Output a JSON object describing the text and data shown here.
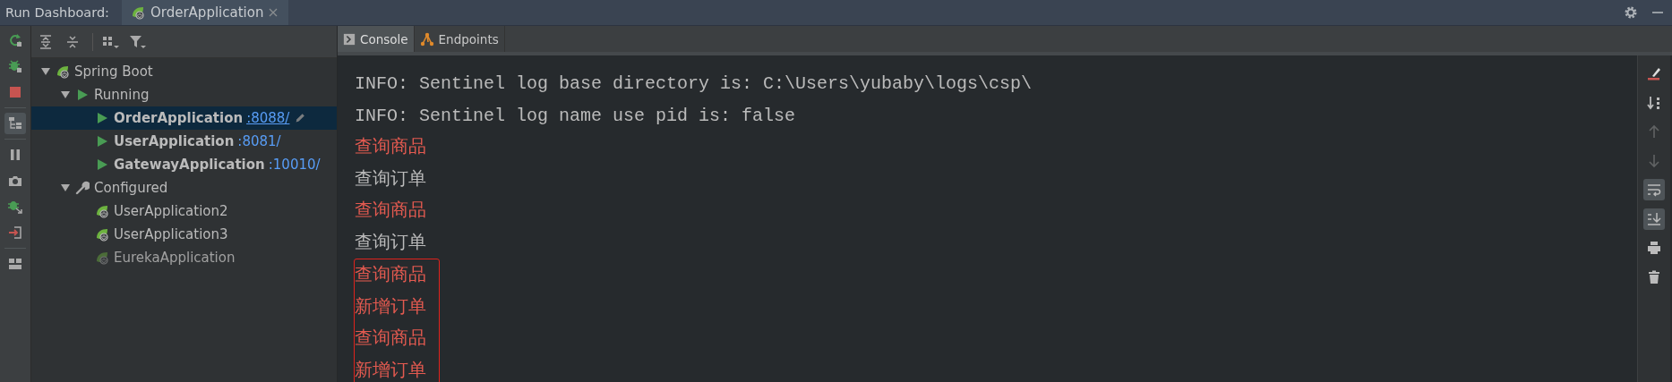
{
  "title_bar": {
    "label": "Run Dashboard:",
    "tab": {
      "title": "OrderApplication",
      "selected": true
    }
  },
  "left_toolbar": [
    {
      "kind": "rerun",
      "on": false
    },
    {
      "kind": "debug",
      "on": false
    },
    {
      "kind": "stop",
      "on": false
    },
    {
      "kind": "group_tree",
      "on": true
    },
    {
      "kind": "pause",
      "on": false
    },
    {
      "kind": "camera",
      "on": false
    },
    {
      "kind": "debug_attach",
      "on": false
    },
    {
      "kind": "login",
      "on": false
    },
    {
      "kind": "layout",
      "on": false
    }
  ],
  "tree_toolbar": [
    {
      "kind": "expand_all"
    },
    {
      "kind": "collapse_all"
    },
    {
      "kind": "group"
    },
    {
      "kind": "filter"
    }
  ],
  "tree": [
    {
      "label": "Spring Boot",
      "kind": "root",
      "expanded": true,
      "selected": false,
      "children": [
        {
          "label": "Running",
          "kind": "running",
          "expanded": true,
          "selected": false,
          "children": [
            {
              "label": "OrderApplication",
              "port": ":8088/",
              "kind": "app",
              "running": true,
              "selected": true
            },
            {
              "label": "UserApplication",
              "port": ":8081/",
              "kind": "app",
              "running": true,
              "selected": false
            },
            {
              "label": "GatewayApplication",
              "port": ":10010/",
              "kind": "app",
              "running": true,
              "selected": false
            }
          ]
        },
        {
          "label": "Configured",
          "kind": "configured",
          "expanded": true,
          "selected": false,
          "children": [
            {
              "label": "UserApplication2",
              "kind": "app",
              "running": false,
              "enabled": true,
              "selected": false
            },
            {
              "label": "UserApplication3",
              "kind": "app",
              "running": false,
              "enabled": true,
              "selected": false
            },
            {
              "label": "EurekaApplication",
              "kind": "app",
              "running": false,
              "enabled": false,
              "selected": false
            }
          ]
        }
      ]
    }
  ],
  "console": {
    "tabs": [
      {
        "label": "Console",
        "kind": "console",
        "selected": true
      },
      {
        "label": "Endpoints",
        "kind": "endpoints",
        "selected": false
      }
    ],
    "lines": [
      {
        "text": "INFO: Sentinel log base directory is: C:\\Users\\yubaby\\logs\\csp\\",
        "kind": "stdout"
      },
      {
        "text": "INFO: Sentinel log name use pid is: false",
        "kind": "stdout"
      },
      {
        "text": "查询商品",
        "kind": "stderr"
      },
      {
        "text": "查询订单",
        "kind": "stdout"
      },
      {
        "text": "查询商品",
        "kind": "stderr"
      },
      {
        "text": "查询订单",
        "kind": "stdout"
      }
    ],
    "boxed_lines": [
      {
        "text": "查询商品",
        "kind": "stderr"
      },
      {
        "text": "新增订单",
        "kind": "stderr"
      },
      {
        "text": "查询商品",
        "kind": "stderr"
      },
      {
        "text": "新增订单",
        "kind": "stderr"
      }
    ]
  },
  "right_toolbar": [
    {
      "kind": "clear",
      "on": false,
      "disabled": false
    },
    {
      "kind": "sort",
      "on": false,
      "disabled": false
    },
    {
      "kind": "up",
      "on": false,
      "disabled": true
    },
    {
      "kind": "down",
      "on": false,
      "disabled": true
    },
    {
      "kind": "soft_wrap",
      "on": true,
      "disabled": false
    },
    {
      "kind": "scroll_end",
      "on": true,
      "disabled": false
    },
    {
      "kind": "print",
      "on": false,
      "disabled": false
    },
    {
      "kind": "trash",
      "on": false,
      "disabled": false
    }
  ]
}
